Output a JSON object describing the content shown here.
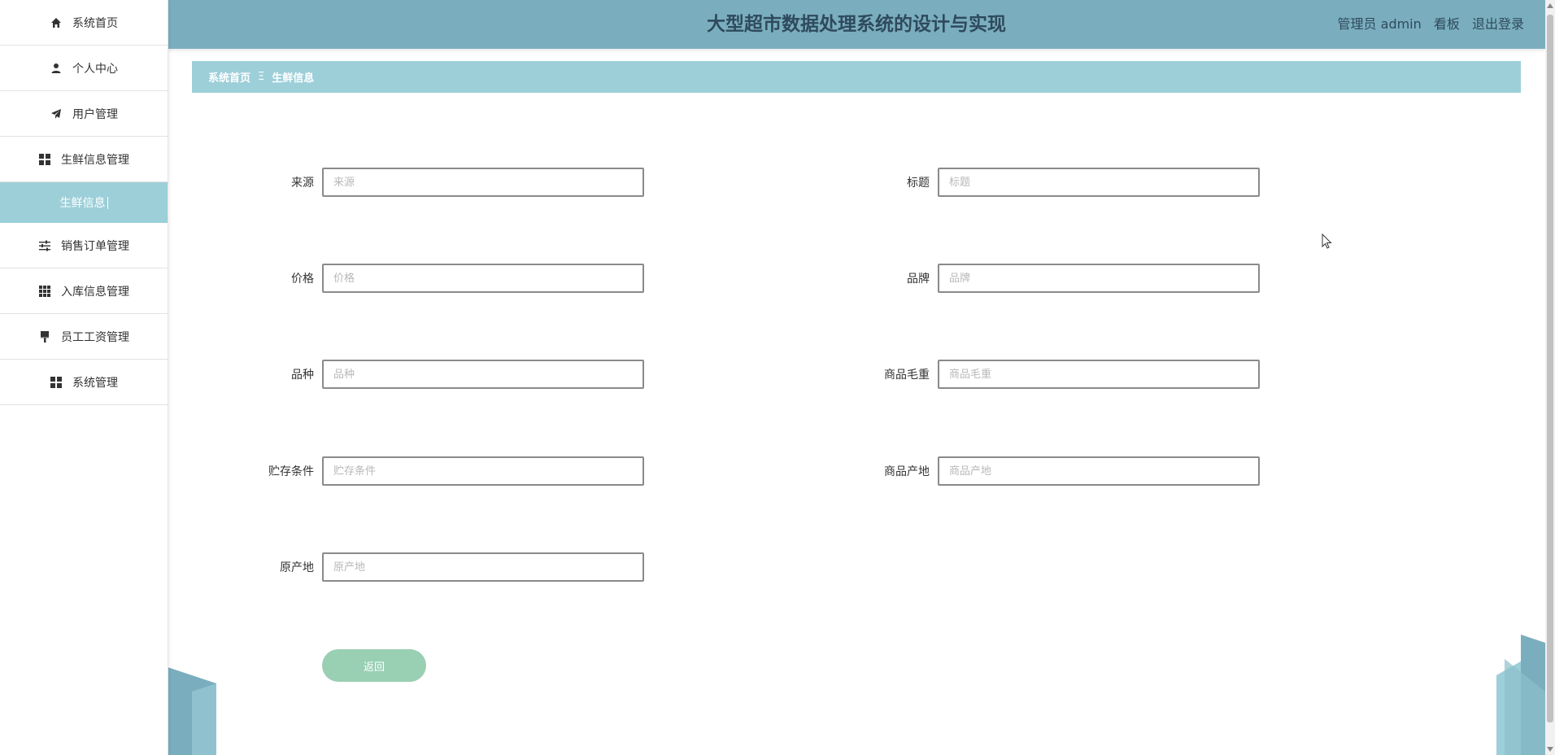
{
  "sidebar": {
    "items": [
      {
        "label": "系统首页",
        "icon": "home-icon"
      },
      {
        "label": "个人中心",
        "icon": "user-icon"
      },
      {
        "label": "用户管理",
        "icon": "send-icon"
      },
      {
        "label": "生鲜信息管理",
        "icon": "grid-icon"
      },
      {
        "label": "生鲜信息",
        "icon": "",
        "active": true
      },
      {
        "label": "销售订单管理",
        "icon": "sliders-icon"
      },
      {
        "label": "入库信息管理",
        "icon": "apps-icon"
      },
      {
        "label": "员工工资管理",
        "icon": "brush-icon"
      },
      {
        "label": "系统管理",
        "icon": "grid-icon"
      }
    ]
  },
  "header": {
    "title": "大型超市数据处理系统的设计与实现",
    "user": "管理员 admin",
    "board": "看板",
    "logout": "退出登录"
  },
  "breadcrumb": {
    "home": "系统首页",
    "separator": "Ξ",
    "current": "生鲜信息"
  },
  "form": {
    "fields": [
      {
        "label": "来源",
        "placeholder": "来源"
      },
      {
        "label": "标题",
        "placeholder": "标题"
      },
      {
        "label": "价格",
        "placeholder": "价格"
      },
      {
        "label": "品牌",
        "placeholder": "品牌"
      },
      {
        "label": "品种",
        "placeholder": "品种"
      },
      {
        "label": "商品毛重",
        "placeholder": "商品毛重"
      },
      {
        "label": "贮存条件",
        "placeholder": "贮存条件"
      },
      {
        "label": "商品产地",
        "placeholder": "商品产地"
      },
      {
        "label": "原产地",
        "placeholder": "原产地"
      }
    ],
    "back_label": "返回"
  },
  "colors": {
    "header_bg": "#7aaebe",
    "accent": "#9dcfd9",
    "button": "#99cfb3"
  }
}
